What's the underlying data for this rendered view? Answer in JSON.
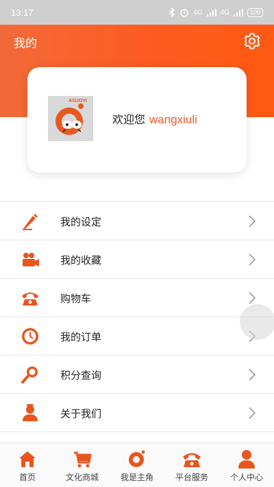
{
  "status_bar": {
    "time": "13:17",
    "network_left": "4G",
    "network_right": "4G",
    "battery": "100"
  },
  "header": {
    "title": "我的"
  },
  "profile": {
    "welcome": "欢迎您",
    "username": "wangxiuli",
    "avatar_badge": "ASUOYI"
  },
  "menu": [
    {
      "label": "我的设定",
      "icon": "pencil-icon"
    },
    {
      "label": "我的收藏",
      "icon": "video-camera-icon"
    },
    {
      "label": "购物车",
      "icon": "telephone-icon"
    },
    {
      "label": "我的订单",
      "icon": "clock-icon"
    },
    {
      "label": "积分查询",
      "icon": "magnifier-icon"
    },
    {
      "label": "关于我们",
      "icon": "user-badge-icon"
    }
  ],
  "tabs": [
    {
      "label": "首页",
      "icon": "home-icon"
    },
    {
      "label": "文化商城",
      "icon": "cart-icon"
    },
    {
      "label": "我是主角",
      "icon": "brand-logo-icon"
    },
    {
      "label": "平台服务",
      "icon": "telephone-icon"
    },
    {
      "label": "个人中心",
      "icon": "person-icon"
    }
  ],
  "colors": {
    "accent": "#ff5a1a",
    "icon": "#e8561e",
    "header_start": "#f36a3a",
    "header_end": "#ff5a12"
  }
}
